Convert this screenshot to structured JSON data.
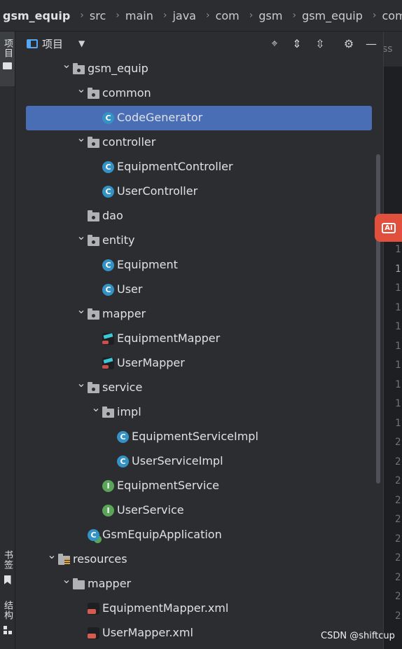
{
  "breadcrumb": {
    "items": [
      "gsm_equip",
      "src",
      "main",
      "java",
      "com",
      "gsm",
      "gsm_equip",
      "com"
    ]
  },
  "left_strip": {
    "project_tab": "项目",
    "bookmarks_tab": "书签",
    "structure_tab": "结构"
  },
  "panel": {
    "title": "项目",
    "icons": [
      "panel-layout-icon",
      "chevron-down-icon",
      "locate-icon",
      "expand-all-icon",
      "collapse-all-icon",
      "gear-icon",
      "minimize-icon"
    ]
  },
  "tree": {
    "rows": [
      {
        "label": "gsm_equip",
        "type": "package",
        "expanded": true
      },
      {
        "label": "common",
        "type": "package",
        "expanded": true
      },
      {
        "label": "CodeGenerator",
        "type": "class",
        "selected": true
      },
      {
        "label": "controller",
        "type": "package",
        "expanded": true
      },
      {
        "label": "EquipmentController",
        "type": "class"
      },
      {
        "label": "UserController",
        "type": "class"
      },
      {
        "label": "dao",
        "type": "package"
      },
      {
        "label": "entity",
        "type": "package",
        "expanded": true
      },
      {
        "label": "Equipment",
        "type": "class"
      },
      {
        "label": "User",
        "type": "class"
      },
      {
        "label": "mapper",
        "type": "package",
        "expanded": true
      },
      {
        "label": "EquipmentMapper",
        "type": "mapper"
      },
      {
        "label": "UserMapper",
        "type": "mapper"
      },
      {
        "label": "service",
        "type": "package",
        "expanded": true
      },
      {
        "label": "impl",
        "type": "package",
        "expanded": true
      },
      {
        "label": "EquipmentServiceImpl",
        "type": "class"
      },
      {
        "label": "UserServiceImpl",
        "type": "class"
      },
      {
        "label": "EquipmentService",
        "type": "interface"
      },
      {
        "label": "UserService",
        "type": "interface"
      },
      {
        "label": "GsmEquipApplication",
        "type": "spring-boot-app"
      },
      {
        "label": "resources",
        "type": "resources-folder",
        "expanded": true
      },
      {
        "label": "mapper",
        "type": "folder",
        "expanded": true
      },
      {
        "label": "EquipmentMapper.xml",
        "type": "mybatis-xml"
      },
      {
        "label": "UserMapper.xml",
        "type": "mybatis-xml"
      }
    ]
  },
  "editor_gutter": {
    "tab_text": "ss",
    "line_numbers": [
      "1",
      "1",
      "1",
      "1",
      "1",
      "1",
      "1",
      "1",
      "1",
      "1",
      "2",
      "2",
      "2",
      "2",
      "2",
      "2",
      "2",
      "2",
      "2",
      "2"
    ],
    "ai_button": "AI"
  },
  "colors": {
    "background": "#2b2d30",
    "selection": "#4a6eb5",
    "class_icon": "#3592c4",
    "interface_icon": "#5aa557",
    "ai_button": "#e0503c"
  },
  "watermark": "CSDN @shiftcup"
}
